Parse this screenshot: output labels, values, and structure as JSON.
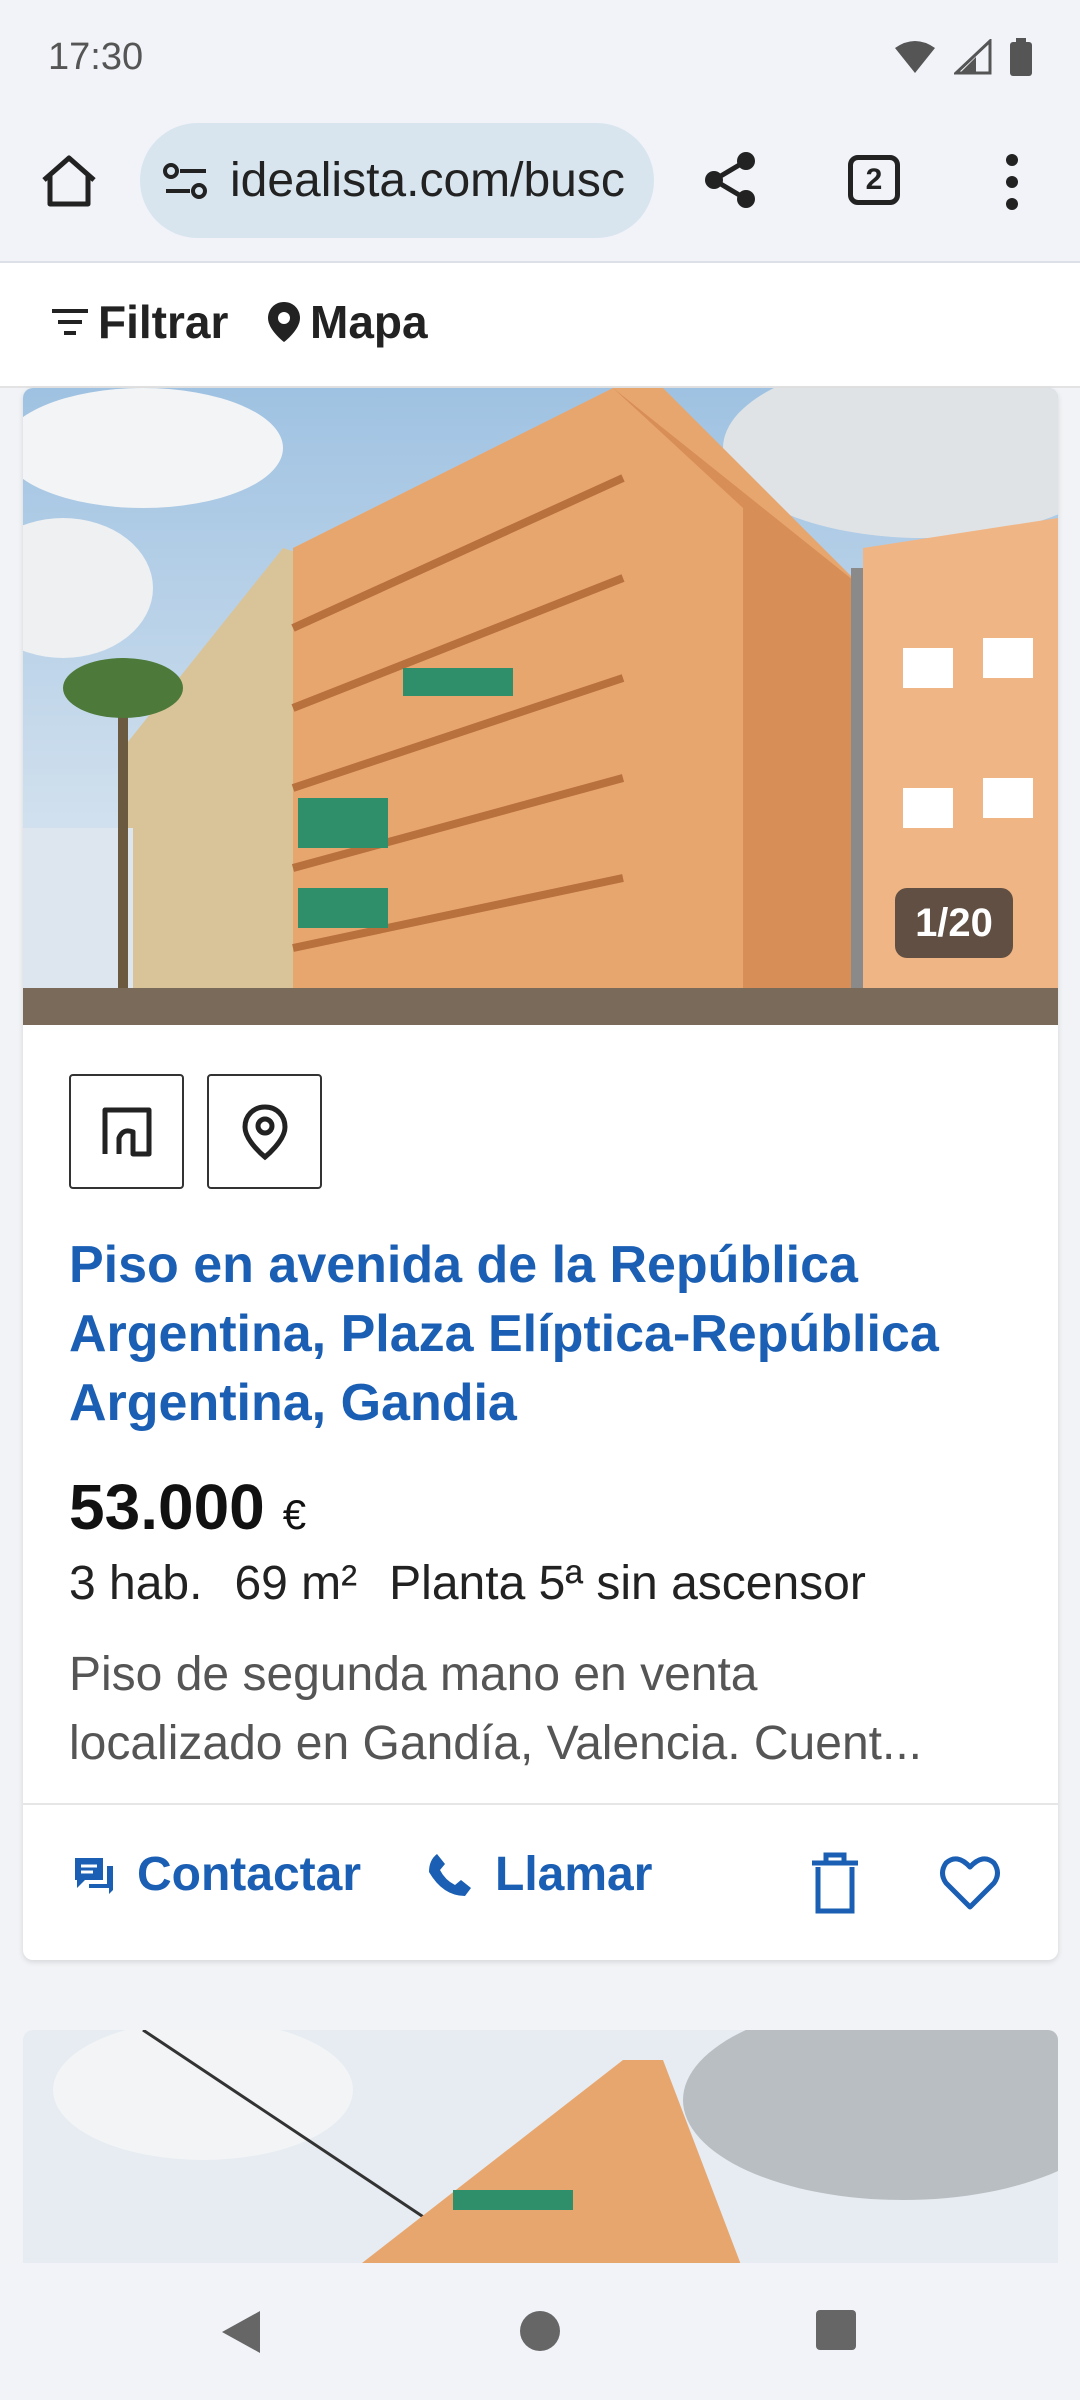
{
  "status_bar": {
    "time": "17:30"
  },
  "browser": {
    "url": "idealista.com/busc",
    "tab_count": "2"
  },
  "filter_bar": {
    "filter_label": "Filtrar",
    "map_label": "Mapa"
  },
  "listing": {
    "photo_counter": "1/20",
    "title": "Piso en avenida de la República Argentina, Plaza Elíptica-República Argentina, Gandia",
    "price": "53.000",
    "currency": "€",
    "rooms": "3 hab.",
    "area": "69 m²",
    "floor": "Planta 5ª sin ascensor",
    "description_line1": "Piso de segunda mano en venta",
    "description_line2": "localizado en Gandía, Valencia. Cuent...",
    "contact_label": "Contactar",
    "call_label": "Llamar"
  },
  "colors": {
    "accent": "#1a5fb4",
    "building": "#e8a66f",
    "sky": "#bcd6ec"
  },
  "icons": [
    "wifi-icon",
    "signal-icon",
    "battery-icon",
    "home-icon",
    "tune-icon",
    "share-icon",
    "more-vert-icon",
    "filter-icon",
    "location-pin-icon",
    "floor-plan-icon",
    "map-pin-icon",
    "chat-icon",
    "phone-icon",
    "trash-icon",
    "heart-icon",
    "back-icon",
    "home-circle-icon",
    "recents-icon"
  ]
}
